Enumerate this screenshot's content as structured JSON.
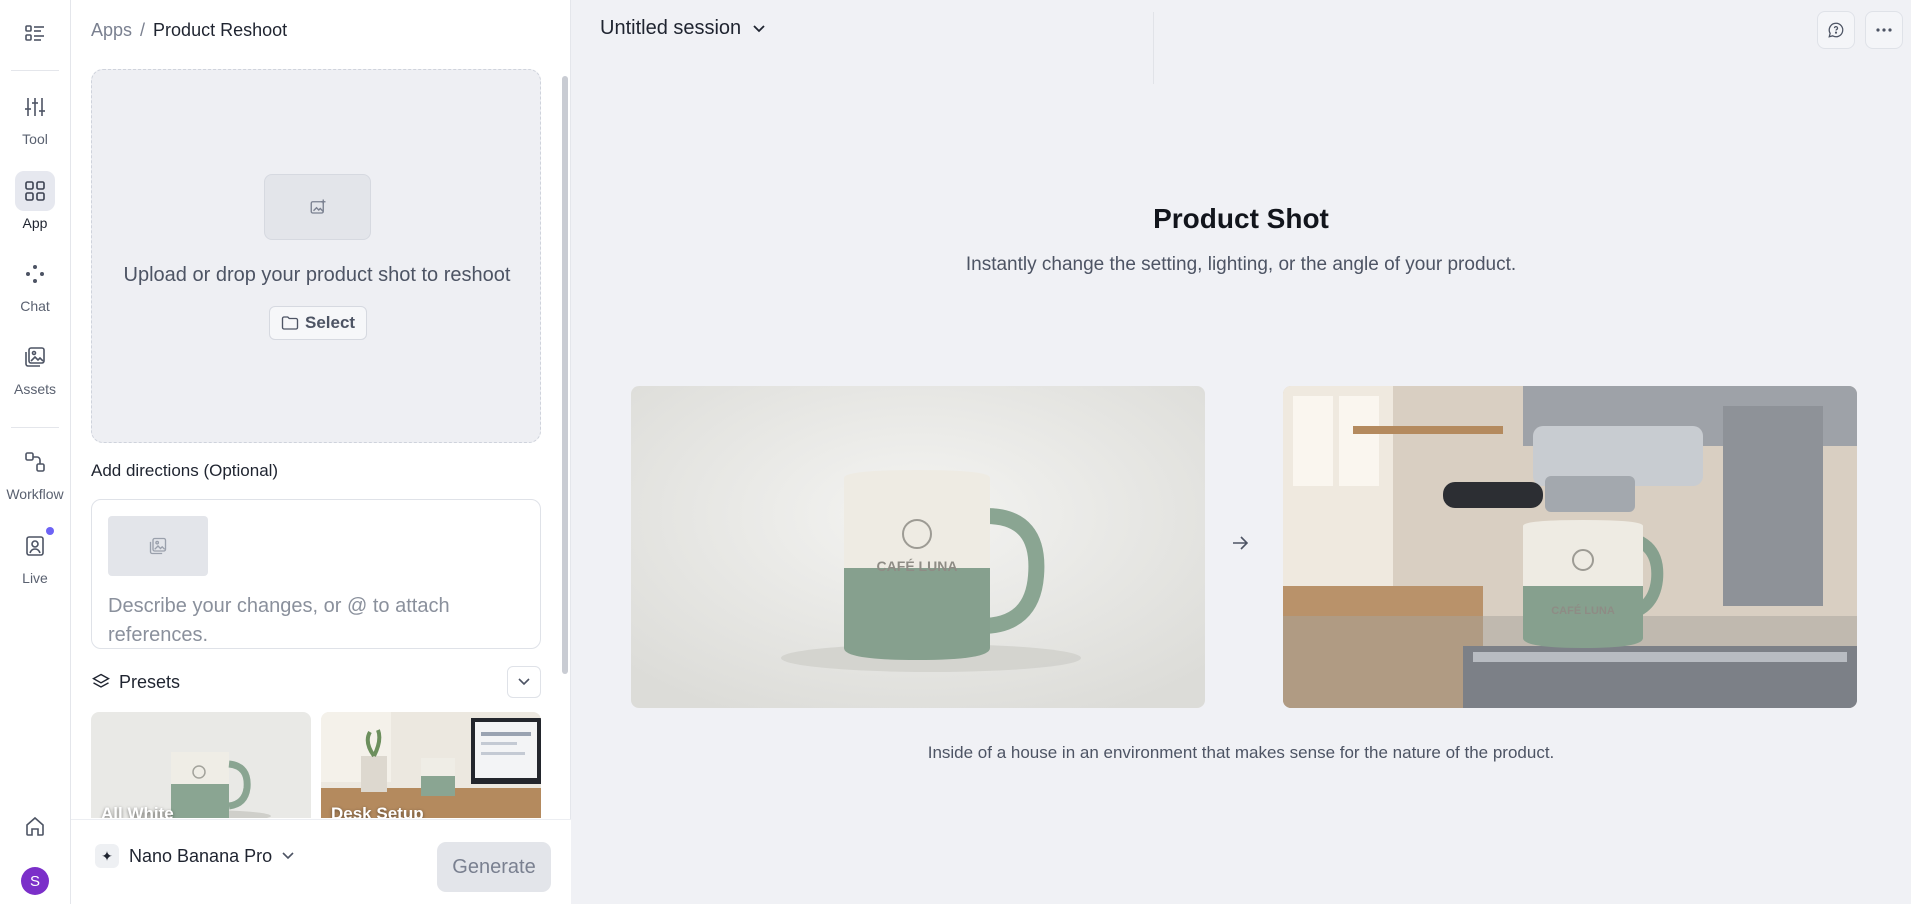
{
  "rail": {
    "items": [
      {
        "label": "Tool"
      },
      {
        "label": "App"
      },
      {
        "label": "Chat"
      },
      {
        "label": "Assets"
      },
      {
        "label": "Workflow"
      },
      {
        "label": "Live"
      }
    ],
    "avatar_initial": "S",
    "accent": "#6d63f5"
  },
  "breadcrumb": {
    "root": "Apps",
    "separator": "/",
    "current": "Product Reshoot"
  },
  "upload": {
    "prompt": "Upload or drop your product shot to reshoot",
    "select_label": "Select"
  },
  "directions": {
    "title": "Add directions (Optional)",
    "placeholder": "Describe your changes, or @ to attach references."
  },
  "presets": {
    "label": "Presets",
    "items": [
      {
        "label": "All White"
      },
      {
        "label": "Desk Setup"
      }
    ]
  },
  "footer": {
    "model": "Nano Banana Pro",
    "generate": "Generate"
  },
  "session": {
    "title": "Untitled session"
  },
  "hero": {
    "title": "Product Shot",
    "subtitle": "Instantly change the setting, lighting, or the angle of your product.",
    "caption": "Inside of a house in an environment that makes sense for the nature of the product.",
    "product_text": "CAFÉ LUNA"
  }
}
